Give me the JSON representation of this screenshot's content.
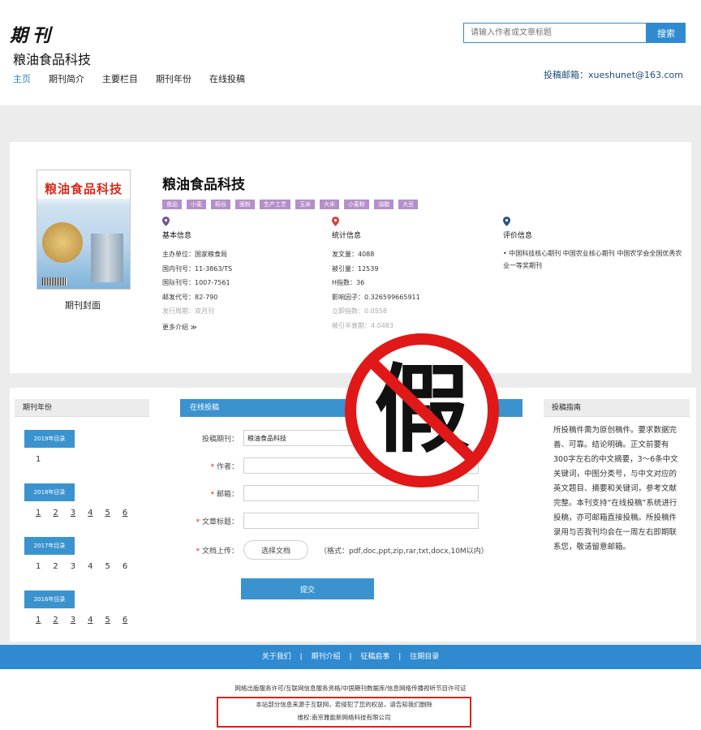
{
  "header": {
    "logo_script": "期刊",
    "site_title": "粮油食品科技",
    "nav": [
      "主页",
      "期刊简介",
      "主要栏目",
      "期刊年份",
      "在线投稿"
    ],
    "search_placeholder": "请输入作者或文章标题",
    "search_button": "搜索",
    "email": "投稿邮箱：xueshunet@163.com"
  },
  "journal": {
    "cover_name": "粮油食品科技",
    "cover_label": "期刊封面",
    "title": "粮油食品科技",
    "tags": [
      "食品",
      "小麦",
      "稻谷",
      "面粉",
      "生产工艺",
      "玉米",
      "大米",
      "小麦粉",
      "油脂",
      "大豆"
    ],
    "basic": {
      "heading": "基本信息",
      "lines": [
        "主办单位：国家粮食局",
        "国内刊号：11-3863/TS",
        "国际刊号：1007-7561",
        "邮发代号：82-790",
        "发行周期：双月刊"
      ],
      "more": "更多介绍 ≫"
    },
    "stats": {
      "heading": "统计信息",
      "lines": [
        "发文量：4088",
        "被引量：12539",
        "H指数：36",
        "影响因子：0.326599665911",
        "立即指数：0.0558",
        "被引半衰期：4.0483"
      ]
    },
    "eval": {
      "heading": "评价信息",
      "lines": [
        "• 中国科技核心期刊 中国农业核心期刊 中国农学会全国优秀农业一等奖期刊"
      ]
    },
    "pin_colors": [
      "#7a4e8c",
      "#d44040",
      "#2a4f86"
    ]
  },
  "years": {
    "heading": "期刊年份",
    "groups": [
      {
        "label": "2019年目录",
        "issues": [
          "1"
        ],
        "underline": false
      },
      {
        "label": "2018年目录",
        "issues": [
          "1",
          "2",
          "3",
          "4",
          "5",
          "6"
        ],
        "underline": true
      },
      {
        "label": "2017年目录",
        "issues": [
          "1",
          "2",
          "3",
          "4",
          "5",
          "6"
        ],
        "underline": false
      },
      {
        "label": "2016年目录",
        "issues": [
          "1",
          "2",
          "3",
          "4",
          "5",
          "6"
        ],
        "underline": true
      }
    ]
  },
  "submit": {
    "heading": "在线投稿",
    "journal_label": "投稿期刊：",
    "journal_value": "粮油食品科技",
    "author_label": "作者：",
    "email_label": "邮箱：",
    "article_label": "文章标题：",
    "upload_label": "文档上传：",
    "upload_button": "选择文档",
    "formats": "（格式：pdf,doc,ppt,zip,rar,txt,docx,10M以内）",
    "submit_button": "提交",
    "required_mark": "*"
  },
  "guide": {
    "heading": "投稿指南",
    "text": "所投稿件需为原创稿件。要求数据完善、可靠。结论明确。正文前要有300字左右的中文摘要，3～6条中文关键词，中图分类号，与中文对应的英文题目、摘要和关键词，参考文献完整。本刊支持“在线投稿”系统进行投稿，亦可邮箱直接投稿。所投稿件录用与否我刊均会在一周左右即期联系您，敬请留意邮箱。"
  },
  "stamp": {
    "char": "假",
    "color": "#e01818"
  },
  "footer": {
    "links": [
      "关于我们",
      "期刊介绍",
      "征稿启事",
      "往期目录"
    ],
    "separator": "|",
    "license": "网络出版服务许可/互联网信息服务资格/中国期刊数据库/信息网络传播视听节目许可证",
    "disclaimer_1": "本站部分信息来源于互联网，若侵犯了您的权益，请告知我们删除",
    "disclaimer_2": "维权:南京雅能新网络科技有限公司"
  }
}
